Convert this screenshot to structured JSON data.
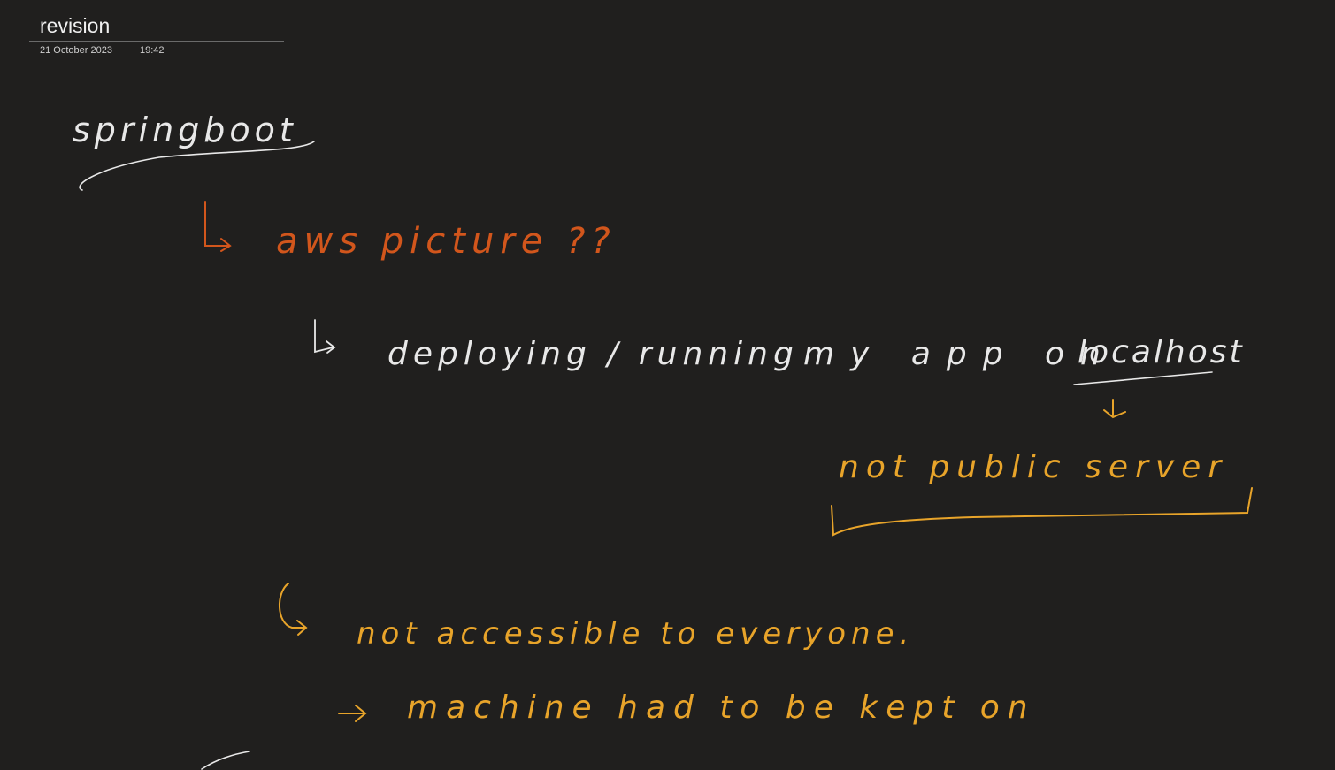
{
  "page": {
    "title": "revision",
    "date": "21 October 2023",
    "time": "19:42"
  },
  "colors": {
    "background": "#201f1e",
    "white_ink": "#e8e8e8",
    "orange_ink": "#d2561c",
    "gold_ink": "#e8a42a"
  },
  "notes": {
    "line1": "springboot",
    "line2": "aws picture ??",
    "line3_a": "deploying / running",
    "line3_b": "my app on",
    "line3_c": "localhost",
    "line4": "not public server",
    "line5": "not accessible to everyone.",
    "line6": "machine had to be kept on"
  }
}
